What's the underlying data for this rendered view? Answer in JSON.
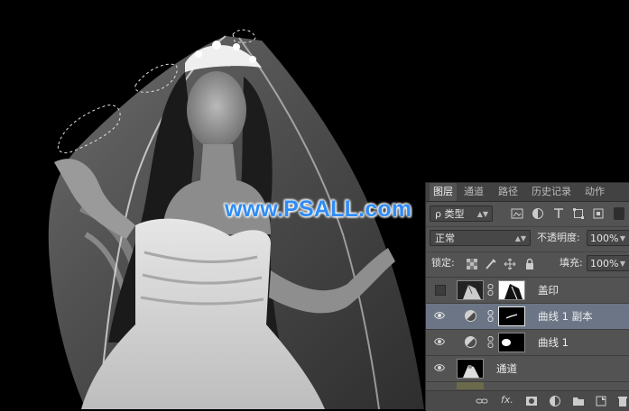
{
  "watermark": "www.PSALL.com",
  "layers_panel": {
    "tabs": [
      "图层",
      "通道",
      "路径",
      "历史记录",
      "动作"
    ],
    "active_tab": "图层",
    "filter": {
      "label": "ρ 类型",
      "filter_icons": [
        "image-filter-icon",
        "adjustment-filter-icon",
        "type-filter-icon",
        "shape-filter-icon",
        "smartobject-filter-icon",
        "filter-toggle-icon"
      ]
    },
    "blend_mode": "正常",
    "opacity_label": "不透明度:",
    "opacity_value": "100%",
    "lock_label": "锁定:",
    "fill_label": "填充:",
    "fill_value": "100%",
    "layers": [
      {
        "name": "盖印",
        "visible": false,
        "type": "pixel-with-mask"
      },
      {
        "name": "曲线 1 副本",
        "visible": true,
        "type": "curves-adjustment",
        "selected": true
      },
      {
        "name": "曲线 1",
        "visible": true,
        "type": "curves-adjustment"
      },
      {
        "name": "通道",
        "visible": true,
        "type": "pixel"
      }
    ],
    "bottom_icons": [
      "link-layers-icon",
      "fx-icon",
      "add-mask-icon",
      "new-adjustment-icon",
      "new-group-icon",
      "new-layer-icon",
      "delete-icon"
    ],
    "fx_label": "fx."
  },
  "colors": {
    "panel_bg": "#535353",
    "selected_layer": "#6b7585",
    "watermark": "#2f8cf5"
  }
}
